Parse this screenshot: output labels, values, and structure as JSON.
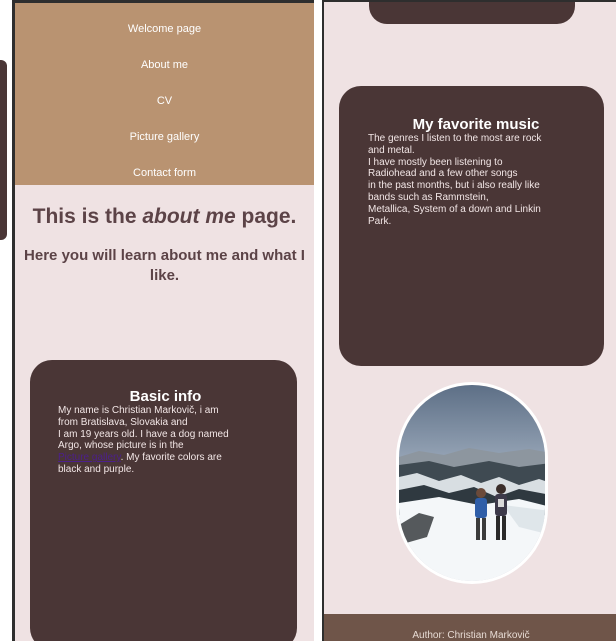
{
  "nav": {
    "items": [
      "Welcome page",
      "About me",
      "CV",
      "Picture gallery",
      "Contact form"
    ]
  },
  "heading": {
    "prefix": "This is the ",
    "emphasis": "about me",
    "suffix": " page."
  },
  "subheading": "Here you will learn about me and what I like.",
  "basic_info": {
    "title": "Basic info",
    "lines": [
      "My name is Christian Markovič, i am",
      "from Bratislava, Slovakia and",
      "I am 19 years old. I have a dog named",
      "Argo, whose picture is in the"
    ],
    "link_text": "Picture gallery",
    "after_link": ". My favorite colors are",
    "last_line": "black and purple."
  },
  "music": {
    "title": "My favorite music",
    "lines": [
      "The genres I listen to the most are rock",
      "and metal.",
      "I have mostly been listening to",
      "Radiohead and a few other songs",
      "in the past months, but i also really like",
      "bands such as Rammstein,",
      "Metallica, System of a down and Linkin",
      "Park."
    ]
  },
  "footer": {
    "text": "Author: Christian Markovič"
  },
  "colors": {
    "page_bg": "#efe2e3",
    "nav_bg": "#b99371",
    "card_bg": "#4a3636",
    "heading": "#5c4347",
    "footer_bg": "#6f5549"
  },
  "icons": [
    "photo-mountain-snow"
  ]
}
